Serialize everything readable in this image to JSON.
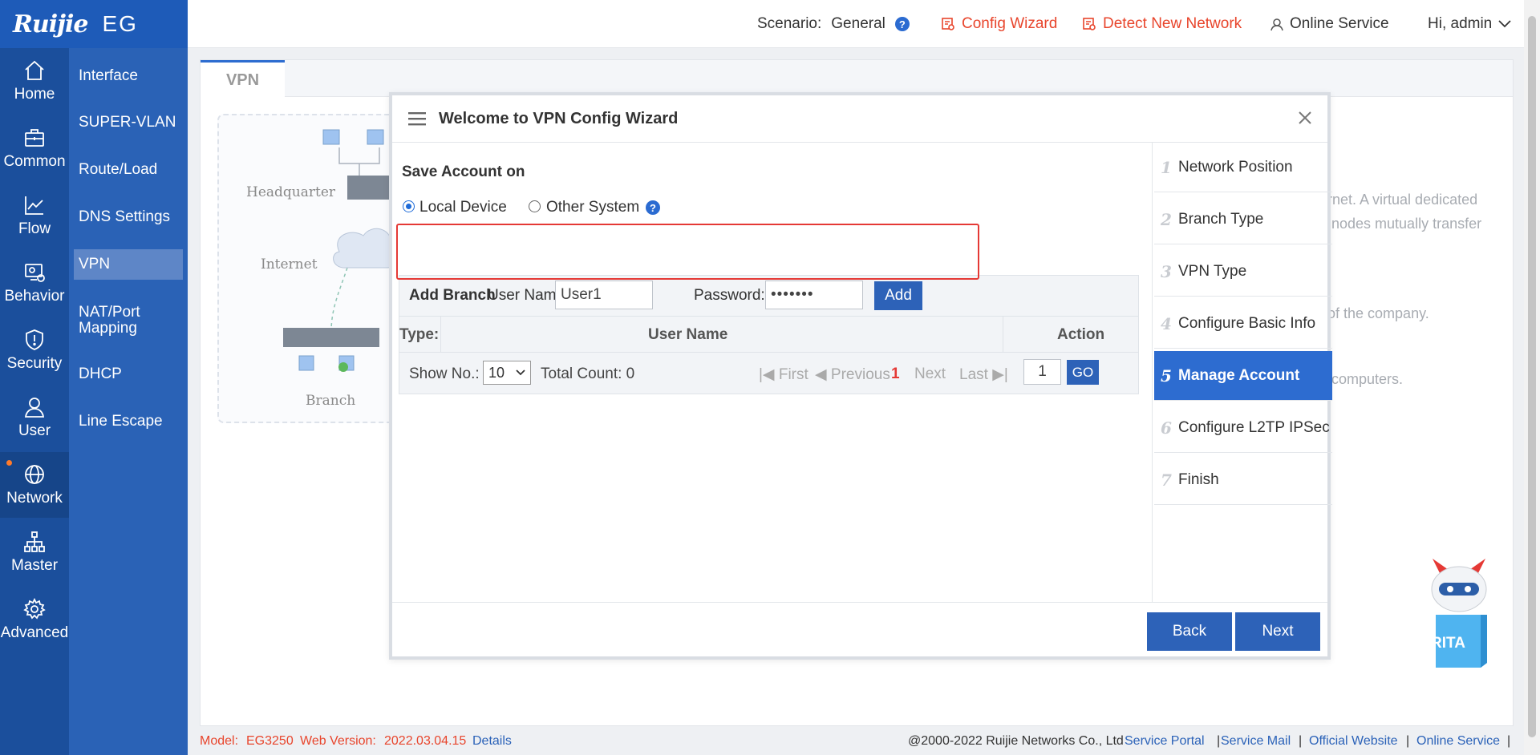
{
  "brand": {
    "logo": "Ruijie",
    "model": "EG"
  },
  "rail": [
    {
      "label": "Home",
      "icon": "home-icon"
    },
    {
      "label": "Common",
      "icon": "briefcase-icon"
    },
    {
      "label": "Flow",
      "icon": "chart-icon"
    },
    {
      "label": "Behavior",
      "icon": "behavior-icon"
    },
    {
      "label": "Security",
      "icon": "shield-icon"
    },
    {
      "label": "User",
      "icon": "user-icon"
    },
    {
      "label": "Network",
      "icon": "globe-icon",
      "active": true
    },
    {
      "label": "Master",
      "icon": "hierarchy-icon"
    },
    {
      "label": "Advanced",
      "icon": "gear-icon"
    }
  ],
  "subnav": [
    {
      "label": "Interface"
    },
    {
      "label": "SUPER-VLAN"
    },
    {
      "label": "Route/Load"
    },
    {
      "label": "DNS Settings"
    },
    {
      "label": "VPN",
      "active": true
    },
    {
      "label": "NAT/Port Mapping"
    },
    {
      "label": "DHCP"
    },
    {
      "label": "Line Escape"
    }
  ],
  "topbar": {
    "scenario_label": "Scenario:",
    "scenario_value": "General",
    "config_wizard": "Config Wizard",
    "detect_network": "Detect New Network",
    "online_service": "Online Service",
    "greeting": "Hi, admin"
  },
  "tabs": {
    "vpn": "VPN"
  },
  "diagram": {
    "headquarter": "Headquarter",
    "internet": "Internet",
    "branch": "Branch"
  },
  "background_text": {
    "line1": "rnet. A virtual dedicated",
    "line2": "nodes mutually transfer",
    "line3": "of the company.",
    "line4": "computers."
  },
  "modal": {
    "title": "Welcome to VPN Config Wizard",
    "save_account_on": "Save Account on",
    "radio_local": "Local Device",
    "radio_other": "Other System",
    "add_branch": "Add Branch",
    "username_label": "User Name:",
    "username_value": "User1",
    "password_label": "Password:",
    "password_value": "•••••••",
    "add_button": "Add",
    "table": {
      "type_col": "Type:",
      "username_col": "User Name",
      "action_col": "Action"
    },
    "pager": {
      "show_no": "Show No.:",
      "page_size": "10",
      "total_count": "Total Count: 0",
      "first": "First",
      "previous": "Previous",
      "current": "1",
      "next": "Next",
      "last": "Last",
      "goto_value": "1",
      "go": "GO"
    },
    "steps": [
      {
        "num": "1",
        "label": "Network Position"
      },
      {
        "num": "2",
        "label": "Branch Type"
      },
      {
        "num": "3",
        "label": "VPN Type"
      },
      {
        "num": "4",
        "label": "Configure Basic Info"
      },
      {
        "num": "5",
        "label": "Manage Account",
        "active": true
      },
      {
        "num": "6",
        "label": "Configure L2TP IPSec"
      },
      {
        "num": "7",
        "label": "Finish"
      }
    ],
    "back": "Back",
    "next": "Next"
  },
  "rita": {
    "label": "RITA"
  },
  "footer": {
    "model_label": "Model:",
    "model_value": "EG3250",
    "web_version_label": "Web Version:",
    "web_version_value": "2022.03.04.15",
    "details": "Details",
    "copyright": "@2000-2022 Ruijie Networks Co., Ltd",
    "service_portal": "Service Portal",
    "service_mail": "Service Mail",
    "official_website": "Official Website",
    "online_service": "Online Service",
    "separator": "|"
  },
  "colors": {
    "accent": "#2d6cd0",
    "nav_dark": "#1b4f9c",
    "nav": "#2a62b6",
    "alert_red": "#e8452c"
  }
}
